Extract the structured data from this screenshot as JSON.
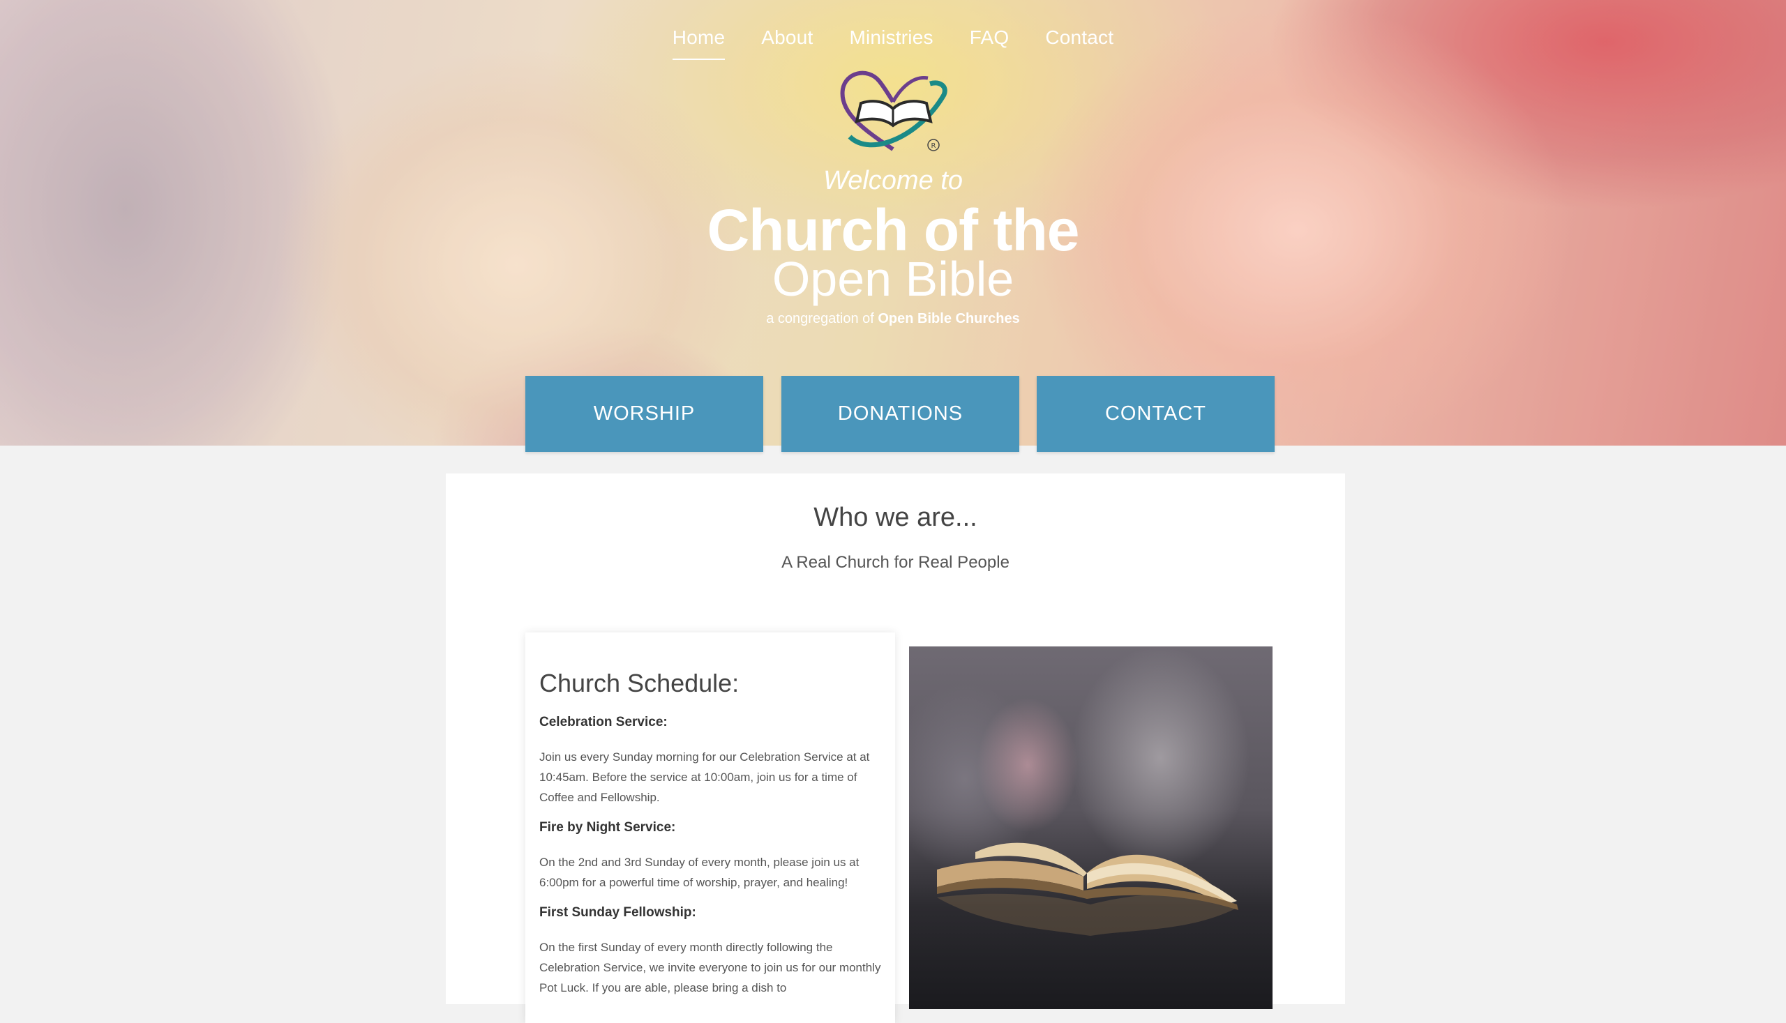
{
  "nav": {
    "items": [
      {
        "label": "Home"
      },
      {
        "label": "About"
      },
      {
        "label": "Ministries"
      },
      {
        "label": "FAQ"
      },
      {
        "label": "Contact"
      }
    ]
  },
  "hero": {
    "welcome": "Welcome to",
    "title_line1": "Church of the",
    "title_line2": "Open Bible",
    "subtitle_prefix": "a congregation of",
    "subtitle_org": "Open Bible Churches"
  },
  "buttons": {
    "worship": "WORSHIP",
    "donations": "DONATIONS",
    "contact": "CONTACT"
  },
  "who": {
    "title": "Who we are...",
    "subtitle": "A Real Church for Real People"
  },
  "schedule": {
    "title": "Church Schedule:",
    "sections": [
      {
        "heading": "Celebration Service:",
        "body": "Join us every Sunday morning for our Celebration Service at at 10:45am. Before the service at 10:00am, join us for a time of Coffee and Fellowship."
      },
      {
        "heading": "Fire by Night Service:",
        "body": "On the 2nd and 3rd Sunday of every month, please join us at 6:00pm for a powerful time of worship, prayer, and healing!"
      },
      {
        "heading": "First Sunday Fellowship:",
        "body": "On the first Sunday of every month directly following the Celebration Service, we invite everyone to join us for our monthly Pot Luck. If you are able, please bring a dish to"
      }
    ]
  },
  "colors": {
    "button_blue": "#4a96bb",
    "logo_purple": "#6b3e8c",
    "logo_teal": "#1a8a87"
  },
  "icons": {
    "logo": "open-bible-heart-logo"
  }
}
